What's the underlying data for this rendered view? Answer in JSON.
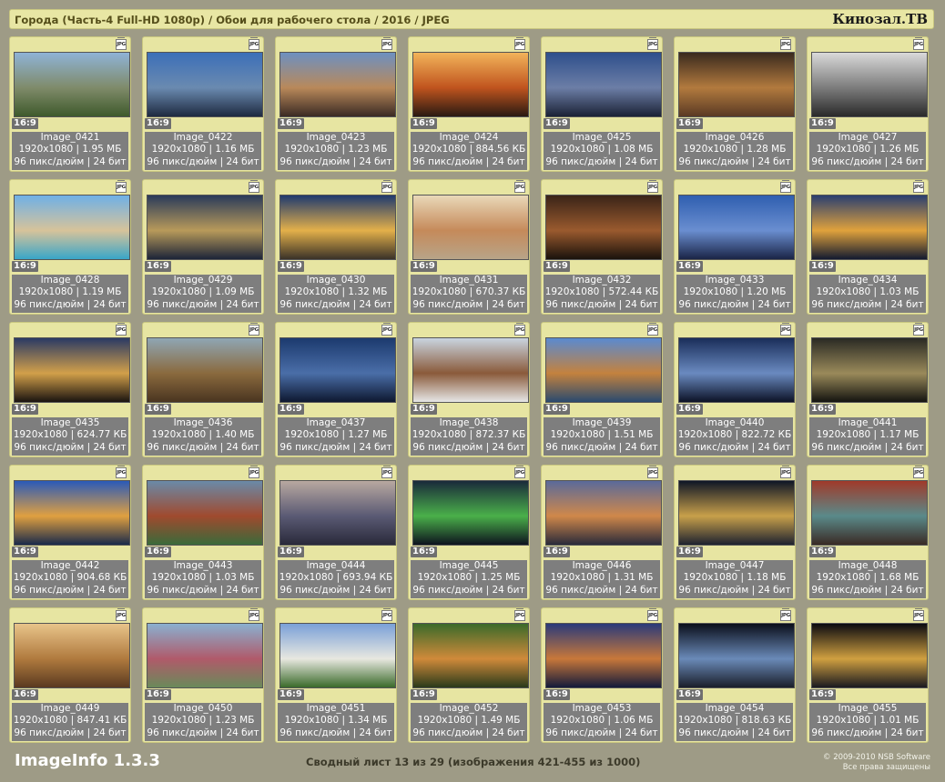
{
  "header": {
    "title": "Города (Часть-4 Full-HD 1080p) / Обои для рабочего стола / 2016 / JPEG",
    "brand": "Кинозал.ТВ"
  },
  "tile_common": {
    "file_badge": "JPG",
    "ratio": "16:9"
  },
  "images": [
    {
      "name": "Image_0421",
      "size": "1920x1080 | 1.95 МБ",
      "meta": "96 пикс/дюйм | 24 бит",
      "colors": [
        "#8fb3d6",
        "#7f8b6a",
        "#3f5a2c"
      ]
    },
    {
      "name": "Image_0422",
      "size": "1920x1080 | 1.16 МБ",
      "meta": "96 пикс/дюйм | 24 бит",
      "colors": [
        "#3c6fb8",
        "#6a8ab0",
        "#1e2a40"
      ]
    },
    {
      "name": "Image_0423",
      "size": "1920x1080 | 1.23 МБ",
      "meta": "96 пикс/дюйм | 24 бит",
      "colors": [
        "#6d90c0",
        "#b9895a",
        "#3b2a24"
      ]
    },
    {
      "name": "Image_0424",
      "size": "1920x1080 | 884.56 КБ",
      "meta": "96 пикс/дюйм | 24 бит",
      "colors": [
        "#f2b35a",
        "#c0541e",
        "#2a1a12"
      ]
    },
    {
      "name": "Image_0425",
      "size": "1920x1080 | 1.08 МБ",
      "meta": "96 пикс/дюйм | 24 бит",
      "colors": [
        "#2e4f8c",
        "#6c7ea6",
        "#1b2236"
      ]
    },
    {
      "name": "Image_0426",
      "size": "1920x1080 | 1.28 МБ",
      "meta": "96 пикс/дюйм | 24 бит",
      "colors": [
        "#3a2a1e",
        "#b27a3e",
        "#5a3a24"
      ]
    },
    {
      "name": "Image_0427",
      "size": "1920x1080 | 1.26 МБ",
      "meta": "96 пикс/дюйм | 24 бит",
      "colors": [
        "#d9d9d9",
        "#7c7c7c",
        "#2a2a2a"
      ]
    },
    {
      "name": "Image_0428",
      "size": "1920x1080 | 1.19 МБ",
      "meta": "96 пикс/дюйм | 24 бит",
      "colors": [
        "#6fb0e6",
        "#d7c39a",
        "#39a6c8"
      ]
    },
    {
      "name": "Image_0429",
      "size": "1920x1080 | 1.09 МБ",
      "meta": "96 пикс/дюйм | 24 бит",
      "colors": [
        "#2a3b5a",
        "#b89a5a",
        "#1c2438"
      ]
    },
    {
      "name": "Image_0430",
      "size": "1920x1080 | 1.32 МБ",
      "meta": "96 пикс/дюйм | 24 бит",
      "colors": [
        "#1f3a6e",
        "#e3b04a",
        "#3a3228"
      ]
    },
    {
      "name": "Image_0431",
      "size": "1920x1080 | 670.37 КБ",
      "meta": "96 пикс/дюйм | 24 бит",
      "colors": [
        "#e9d8b8",
        "#c58a5a",
        "#b8a488"
      ]
    },
    {
      "name": "Image_0432",
      "size": "1920x1080 | 572.44 КБ",
      "meta": "96 пикс/дюйм | 24 бит",
      "colors": [
        "#3a2418",
        "#9a5a2e",
        "#1a120c"
      ]
    },
    {
      "name": "Image_0433",
      "size": "1920x1080 | 1.20 МБ",
      "meta": "96 пикс/дюйм | 24 бит",
      "colors": [
        "#2f5fb0",
        "#6a8ed0",
        "#1a2446"
      ]
    },
    {
      "name": "Image_0434",
      "size": "1920x1080 | 1.03 МБ",
      "meta": "96 пикс/дюйм | 24 бит",
      "colors": [
        "#2a3f70",
        "#e0a23c",
        "#121a30"
      ]
    },
    {
      "name": "Image_0435",
      "size": "1920x1080 | 624.77 КБ",
      "meta": "96 пикс/дюйм | 24 бит",
      "colors": [
        "#2a3a64",
        "#d2a04a",
        "#1a1410"
      ]
    },
    {
      "name": "Image_0436",
      "size": "1920x1080 | 1.40 МБ",
      "meta": "96 пикс/дюйм | 24 бит",
      "colors": [
        "#8fa6b4",
        "#8a6a3e",
        "#4a3520"
      ]
    },
    {
      "name": "Image_0437",
      "size": "1920x1080 | 1.27 МБ",
      "meta": "96 пикс/дюйм | 24 бит",
      "colors": [
        "#1c3a6e",
        "#4a6ea8",
        "#0e1830"
      ]
    },
    {
      "name": "Image_0438",
      "size": "1920x1080 | 872.37 КБ",
      "meta": "96 пикс/дюйм | 24 бит",
      "colors": [
        "#c9d4e0",
        "#8a5a3a",
        "#e6e6e6"
      ]
    },
    {
      "name": "Image_0439",
      "size": "1920x1080 | 1.51 МБ",
      "meta": "96 пикс/дюйм | 24 бит",
      "colors": [
        "#5a8ad0",
        "#c4823e",
        "#2a4a6e"
      ]
    },
    {
      "name": "Image_0440",
      "size": "1920x1080 | 822.72 КБ",
      "meta": "96 пикс/дюйм | 24 бит",
      "colors": [
        "#1a2e5a",
        "#6a8ac0",
        "#0c1226"
      ]
    },
    {
      "name": "Image_0441",
      "size": "1920x1080 | 1.17 МБ",
      "meta": "96 пикс/дюйм | 24 бит",
      "colors": [
        "#2a2a24",
        "#9a8a5a",
        "#141410"
      ]
    },
    {
      "name": "Image_0442",
      "size": "1920x1080 | 904.68 КБ",
      "meta": "96 пикс/дюйм | 24 бит",
      "colors": [
        "#2a5ab8",
        "#e0a040",
        "#1a2a4a"
      ]
    },
    {
      "name": "Image_0443",
      "size": "1920x1080 | 1.03 МБ",
      "meta": "96 пикс/дюйм | 24 бит",
      "colors": [
        "#6a8aa8",
        "#a04a2e",
        "#3a6a3a"
      ]
    },
    {
      "name": "Image_0444",
      "size": "1920x1080 | 693.94 КБ",
      "meta": "96 пикс/дюйм | 24 бит",
      "colors": [
        "#b8a8a0",
        "#5a5a74",
        "#2a2a3a"
      ]
    },
    {
      "name": "Image_0445",
      "size": "1920x1080 | 1.25 МБ",
      "meta": "96 пикс/дюйм | 24 бит",
      "colors": [
        "#1a2a3a",
        "#4ab04a",
        "#0e141e"
      ]
    },
    {
      "name": "Image_0446",
      "size": "1920x1080 | 1.31 МБ",
      "meta": "96 пикс/дюйм | 24 бит",
      "colors": [
        "#5a6a9a",
        "#d0884a",
        "#2a2a3a"
      ]
    },
    {
      "name": "Image_0447",
      "size": "1920x1080 | 1.18 МБ",
      "meta": "96 пикс/дюйм | 24 бит",
      "colors": [
        "#0e1626",
        "#c8a04a",
        "#1e2230"
      ]
    },
    {
      "name": "Image_0448",
      "size": "1920x1080 | 1.68 МБ",
      "meta": "96 пикс/дюйм | 24 бит",
      "colors": [
        "#a03a2a",
        "#5a8a8a",
        "#3a2a24"
      ]
    },
    {
      "name": "Image_0449",
      "size": "1920x1080 | 847.41 КБ",
      "meta": "96 пикс/дюйм | 24 бит",
      "colors": [
        "#e8c48a",
        "#b07a3e",
        "#5a3a20"
      ]
    },
    {
      "name": "Image_0450",
      "size": "1920x1080 | 1.23 МБ",
      "meta": "96 пикс/дюйм | 24 бит",
      "colors": [
        "#8ab0d0",
        "#b05a6a",
        "#6a8a5a"
      ]
    },
    {
      "name": "Image_0451",
      "size": "1920x1080 | 1.34 МБ",
      "meta": "96 пикс/дюйм | 24 бит",
      "colors": [
        "#7aa0d8",
        "#e8e8e0",
        "#3a6a2a"
      ]
    },
    {
      "name": "Image_0452",
      "size": "1920x1080 | 1.49 МБ",
      "meta": "96 пикс/дюйм | 24 бит",
      "colors": [
        "#3a6a2a",
        "#d08a3a",
        "#2a3a1a"
      ]
    },
    {
      "name": "Image_0453",
      "size": "1920x1080 | 1.06 МБ",
      "meta": "96 пикс/дюйм | 24 бит",
      "colors": [
        "#2a3a7a",
        "#c8783a",
        "#141a3a"
      ]
    },
    {
      "name": "Image_0454",
      "size": "1920x1080 | 818.63 КБ",
      "meta": "96 пикс/дюйм | 24 бит",
      "colors": [
        "#0a0e1a",
        "#6a8ab8",
        "#1a1e2a"
      ]
    },
    {
      "name": "Image_0455",
      "size": "1920x1080 | 1.01 МБ",
      "meta": "96 пикс/дюйм | 24 бит",
      "colors": [
        "#0a0a10",
        "#d0a040",
        "#1a1a20"
      ]
    }
  ],
  "footer": {
    "app": "ImageInfo 1.3.3",
    "summary": "Сводный лист 13 из 29 (изображения 421-455 из 1000)",
    "copyright_line1": "© 2009-2010 NSB Software",
    "copyright_line2": "Все права защищены"
  }
}
